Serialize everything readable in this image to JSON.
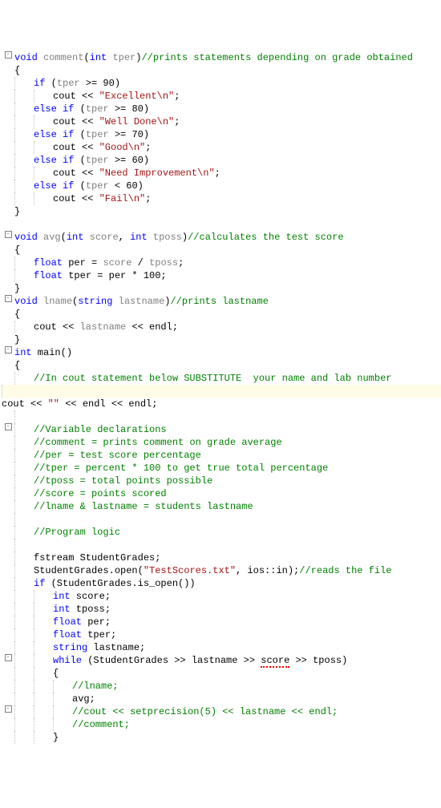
{
  "code": {
    "lines": [
      {
        "fold": "-",
        "indent": 0,
        "segs": [
          [
            "kw-blue",
            "void"
          ],
          [
            "plain",
            " "
          ],
          [
            "gray",
            "comment"
          ],
          [
            "plain",
            "("
          ],
          [
            "kw-blue",
            "int"
          ],
          [
            "plain",
            " "
          ],
          [
            "gray",
            "tper"
          ],
          [
            "plain",
            ")"
          ],
          [
            "comment",
            "//prints statements depending on grade obtained"
          ]
        ]
      },
      {
        "fold": "",
        "indent": 0,
        "segs": [
          [
            "plain",
            "{"
          ]
        ]
      },
      {
        "fold": "",
        "indent": 1,
        "segs": [
          [
            "kw-blue",
            "if"
          ],
          [
            "plain",
            " ("
          ],
          [
            "gray",
            "tper"
          ],
          [
            "plain",
            " >= 90)"
          ]
        ]
      },
      {
        "fold": "",
        "indent": 2,
        "segs": [
          [
            "plain",
            "cout << "
          ],
          [
            "string",
            "\"Excellent"
          ],
          [
            "esc",
            "\\n"
          ],
          [
            "string",
            "\""
          ],
          [
            "plain",
            ";"
          ]
        ]
      },
      {
        "fold": "",
        "indent": 1,
        "segs": [
          [
            "kw-blue",
            "else if"
          ],
          [
            "plain",
            " ("
          ],
          [
            "gray",
            "tper"
          ],
          [
            "plain",
            " >= 80)"
          ]
        ]
      },
      {
        "fold": "",
        "indent": 2,
        "segs": [
          [
            "plain",
            "cout << "
          ],
          [
            "string",
            "\"Well Done"
          ],
          [
            "esc",
            "\\n"
          ],
          [
            "string",
            "\""
          ],
          [
            "plain",
            ";"
          ]
        ]
      },
      {
        "fold": "",
        "indent": 1,
        "segs": [
          [
            "kw-blue",
            "else if"
          ],
          [
            "plain",
            " ("
          ],
          [
            "gray",
            "tper"
          ],
          [
            "plain",
            " >= 70)"
          ]
        ]
      },
      {
        "fold": "",
        "indent": 2,
        "segs": [
          [
            "plain",
            "cout << "
          ],
          [
            "string",
            "\"Good"
          ],
          [
            "esc",
            "\\n"
          ],
          [
            "string",
            "\""
          ],
          [
            "plain",
            ";"
          ]
        ]
      },
      {
        "fold": "",
        "indent": 1,
        "segs": [
          [
            "kw-blue",
            "else if"
          ],
          [
            "plain",
            " ("
          ],
          [
            "gray",
            "tper"
          ],
          [
            "plain",
            " >= 60)"
          ]
        ]
      },
      {
        "fold": "",
        "indent": 2,
        "segs": [
          [
            "plain",
            "cout << "
          ],
          [
            "string",
            "\"Need Improvement"
          ],
          [
            "esc",
            "\\n"
          ],
          [
            "string",
            "\""
          ],
          [
            "plain",
            ";"
          ]
        ]
      },
      {
        "fold": "",
        "indent": 1,
        "segs": [
          [
            "kw-blue",
            "else if"
          ],
          [
            "plain",
            " ("
          ],
          [
            "gray",
            "tper"
          ],
          [
            "plain",
            " < 60)"
          ]
        ]
      },
      {
        "fold": "",
        "indent": 2,
        "segs": [
          [
            "plain",
            "cout << "
          ],
          [
            "string",
            "\"Fail"
          ],
          [
            "esc",
            "\\n"
          ],
          [
            "string",
            "\""
          ],
          [
            "plain",
            ";"
          ]
        ]
      },
      {
        "fold": "",
        "indent": 0,
        "segs": [
          [
            "plain",
            "}"
          ]
        ]
      },
      {
        "fold": "",
        "indent": 0,
        "segs": [
          [
            "plain",
            ""
          ]
        ]
      },
      {
        "fold": "-",
        "indent": 0,
        "segs": [
          [
            "kw-blue",
            "void"
          ],
          [
            "plain",
            " "
          ],
          [
            "gray",
            "avg"
          ],
          [
            "plain",
            "("
          ],
          [
            "kw-blue",
            "int"
          ],
          [
            "plain",
            " "
          ],
          [
            "gray",
            "score"
          ],
          [
            "plain",
            ", "
          ],
          [
            "kw-blue",
            "int"
          ],
          [
            "plain",
            " "
          ],
          [
            "gray",
            "tposs"
          ],
          [
            "plain",
            ")"
          ],
          [
            "comment",
            "//calculates the test score"
          ]
        ]
      },
      {
        "fold": "",
        "indent": 0,
        "segs": [
          [
            "plain",
            "{"
          ]
        ]
      },
      {
        "fold": "",
        "indent": 1,
        "segs": [
          [
            "kw-blue",
            "float"
          ],
          [
            "plain",
            " per = "
          ],
          [
            "gray",
            "score"
          ],
          [
            "plain",
            " / "
          ],
          [
            "gray",
            "tposs"
          ],
          [
            "plain",
            ";"
          ]
        ]
      },
      {
        "fold": "",
        "indent": 1,
        "segs": [
          [
            "kw-blue",
            "float"
          ],
          [
            "plain",
            " tper = per * 100;"
          ]
        ]
      },
      {
        "fold": "",
        "indent": 0,
        "segs": [
          [
            "plain",
            "}"
          ]
        ]
      },
      {
        "fold": "-",
        "indent": 0,
        "segs": [
          [
            "kw-blue",
            "void"
          ],
          [
            "plain",
            " "
          ],
          [
            "gray",
            "lname"
          ],
          [
            "plain",
            "("
          ],
          [
            "kw-blue",
            "string"
          ],
          [
            "plain",
            " "
          ],
          [
            "gray",
            "lastname"
          ],
          [
            "plain",
            ")"
          ],
          [
            "comment",
            "//prints lastname"
          ]
        ]
      },
      {
        "fold": "",
        "indent": 0,
        "segs": [
          [
            "plain",
            "{"
          ]
        ]
      },
      {
        "fold": "",
        "indent": 1,
        "segs": [
          [
            "plain",
            "cout << "
          ],
          [
            "gray",
            "lastname"
          ],
          [
            "plain",
            " << endl;"
          ]
        ]
      },
      {
        "fold": "",
        "indent": 0,
        "segs": [
          [
            "plain",
            "}"
          ]
        ]
      },
      {
        "fold": "-",
        "indent": 0,
        "segs": [
          [
            "kw-blue",
            "int"
          ],
          [
            "plain",
            " main()"
          ]
        ]
      },
      {
        "fold": "",
        "indent": 0,
        "segs": [
          [
            "plain",
            "{"
          ]
        ]
      },
      {
        "fold": "",
        "indent": 1,
        "segs": [
          [
            "comment",
            "//In cout statement below SUBSTITUTE  your name and lab number"
          ]
        ]
      },
      {
        "fold": "",
        "indent": 1,
        "hl": true,
        "segs": [
          [
            "plain",
            "cout << "
          ],
          [
            "string",
            "\"\""
          ],
          [
            "plain",
            " << endl << endl;"
          ]
        ]
      },
      {
        "fold": "",
        "indent": 1,
        "segs": [
          [
            "plain",
            ""
          ]
        ]
      },
      {
        "fold": "-",
        "indent": 1,
        "segs": [
          [
            "comment",
            "//Variable declarations"
          ]
        ]
      },
      {
        "fold": "",
        "indent": 1,
        "segs": [
          [
            "comment",
            "//comment = prints comment on grade average"
          ]
        ]
      },
      {
        "fold": "",
        "indent": 1,
        "segs": [
          [
            "comment",
            "//per = test score percentage"
          ]
        ]
      },
      {
        "fold": "",
        "indent": 1,
        "segs": [
          [
            "comment",
            "//tper = percent * 100 to get true total percentage"
          ]
        ]
      },
      {
        "fold": "",
        "indent": 1,
        "segs": [
          [
            "comment",
            "//tposs = total points possible"
          ]
        ]
      },
      {
        "fold": "",
        "indent": 1,
        "segs": [
          [
            "comment",
            "//score = points scored"
          ]
        ]
      },
      {
        "fold": "",
        "indent": 1,
        "segs": [
          [
            "comment",
            "//lname & lastname = students lastname"
          ]
        ]
      },
      {
        "fold": "",
        "indent": 1,
        "segs": [
          [
            "plain",
            ""
          ]
        ]
      },
      {
        "fold": "",
        "indent": 1,
        "segs": [
          [
            "comment",
            "//Program logic"
          ]
        ]
      },
      {
        "fold": "",
        "indent": 1,
        "segs": [
          [
            "plain",
            ""
          ]
        ]
      },
      {
        "fold": "",
        "indent": 1,
        "segs": [
          [
            "plain",
            "fstream StudentGrades;"
          ]
        ]
      },
      {
        "fold": "",
        "indent": 1,
        "segs": [
          [
            "plain",
            "StudentGrades.open("
          ],
          [
            "string",
            "\"TestScores.txt\""
          ],
          [
            "plain",
            ", ios::in);"
          ],
          [
            "comment",
            "//reads the file"
          ]
        ]
      },
      {
        "fold": "",
        "indent": 1,
        "segs": [
          [
            "kw-blue",
            "if"
          ],
          [
            "plain",
            " (StudentGrades.is_open())"
          ]
        ]
      },
      {
        "fold": "",
        "indent": 2,
        "segs": [
          [
            "kw-blue",
            "int"
          ],
          [
            "plain",
            " score;"
          ]
        ]
      },
      {
        "fold": "",
        "indent": 2,
        "segs": [
          [
            "kw-blue",
            "int"
          ],
          [
            "plain",
            " tposs;"
          ]
        ]
      },
      {
        "fold": "",
        "indent": 2,
        "segs": [
          [
            "kw-blue",
            "float"
          ],
          [
            "plain",
            " per;"
          ]
        ]
      },
      {
        "fold": "",
        "indent": 2,
        "segs": [
          [
            "kw-blue",
            "float"
          ],
          [
            "plain",
            " tper;"
          ]
        ]
      },
      {
        "fold": "",
        "indent": 2,
        "segs": [
          [
            "kw-blue",
            "string"
          ],
          [
            "plain",
            " lastname;"
          ]
        ]
      },
      {
        "fold": "-",
        "indent": 2,
        "segs": [
          [
            "kw-blue",
            "while"
          ],
          [
            "plain",
            " (StudentGrades >> lastname >> "
          ],
          [
            "squiggle",
            "score"
          ],
          [
            "plain",
            " >> tposs)"
          ]
        ]
      },
      {
        "fold": "",
        "indent": 2,
        "segs": [
          [
            "plain",
            "{"
          ]
        ]
      },
      {
        "fold": "",
        "indent": 3,
        "segs": [
          [
            "comment",
            "//lname;"
          ]
        ]
      },
      {
        "fold": "",
        "indent": 3,
        "segs": [
          [
            "plain",
            "avg;"
          ]
        ]
      },
      {
        "fold": "-",
        "indent": 3,
        "segs": [
          [
            "comment",
            "//cout << setprecision(5) << lastname << endl;"
          ]
        ]
      },
      {
        "fold": "",
        "indent": 3,
        "segs": [
          [
            "comment",
            "//comment;"
          ]
        ]
      },
      {
        "fold": "",
        "indent": 2,
        "segs": [
          [
            "plain",
            "}"
          ]
        ]
      }
    ]
  }
}
